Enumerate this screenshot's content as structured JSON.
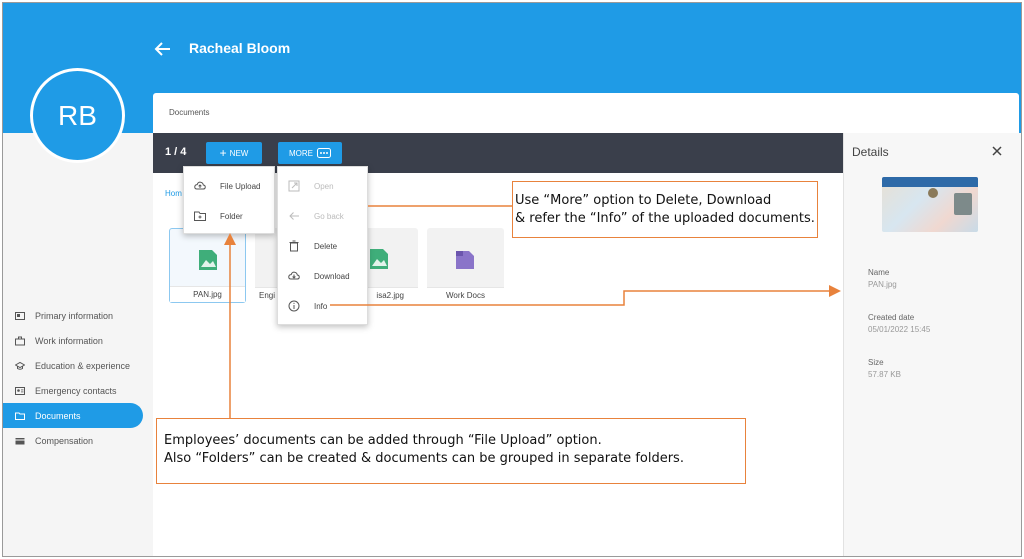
{
  "header": {
    "user_name": "Racheal Bloom",
    "avatar_initials": "RB"
  },
  "sidebar": {
    "items": [
      {
        "label": "Primary information",
        "icon": "id-card-icon"
      },
      {
        "label": "Work information",
        "icon": "briefcase-icon"
      },
      {
        "label": "Education & experience",
        "icon": "graduation-cap-icon"
      },
      {
        "label": "Emergency contacts",
        "icon": "contact-card-icon"
      },
      {
        "label": "Documents",
        "icon": "folder-icon",
        "active": true
      },
      {
        "label": "Compensation",
        "icon": "wallet-icon"
      }
    ]
  },
  "documents": {
    "title": "Documents",
    "counter": "1 / 4",
    "new_label": "NEW",
    "more_label": "MORE",
    "breadcrumb": "Hom",
    "files": [
      {
        "name": "PAN.jpg",
        "type": "image",
        "selected": true
      },
      {
        "name": "Engi",
        "type": "image"
      },
      {
        "name": "isa2.jpg",
        "type": "image"
      },
      {
        "name": "Work Docs",
        "type": "folder"
      }
    ]
  },
  "new_menu": {
    "items": [
      "File Upload",
      "Folder"
    ]
  },
  "more_menu": {
    "items": [
      {
        "label": "Open",
        "icon": "open-external-icon",
        "disabled": true
      },
      {
        "label": "Go back",
        "icon": "arrow-left-icon",
        "disabled": true
      },
      {
        "label": "Delete",
        "icon": "trash-icon"
      },
      {
        "label": "Download",
        "icon": "cloud-download-icon"
      },
      {
        "label": "Info",
        "icon": "info-icon"
      }
    ]
  },
  "details": {
    "title": "Details",
    "name_label": "Name",
    "name_value": "PAN.jpg",
    "created_label": "Created date",
    "created_value": "05/01/2022 15:45",
    "size_label": "Size",
    "size_value": "57.87 KB"
  },
  "callouts": {
    "more": {
      "line1": "Use “More” option to Delete, Download",
      "line2": "& refer the “Info” of the uploaded documents."
    },
    "upload": {
      "line1": "Employees’ documents can be added through “File Upload” option.",
      "line2": "Also “Folders” can be created & documents can be grouped in separate folders."
    }
  },
  "colors": {
    "primary": "#1f9be6",
    "toolbar": "#3a3f4b",
    "callout_border": "#e8823c"
  }
}
